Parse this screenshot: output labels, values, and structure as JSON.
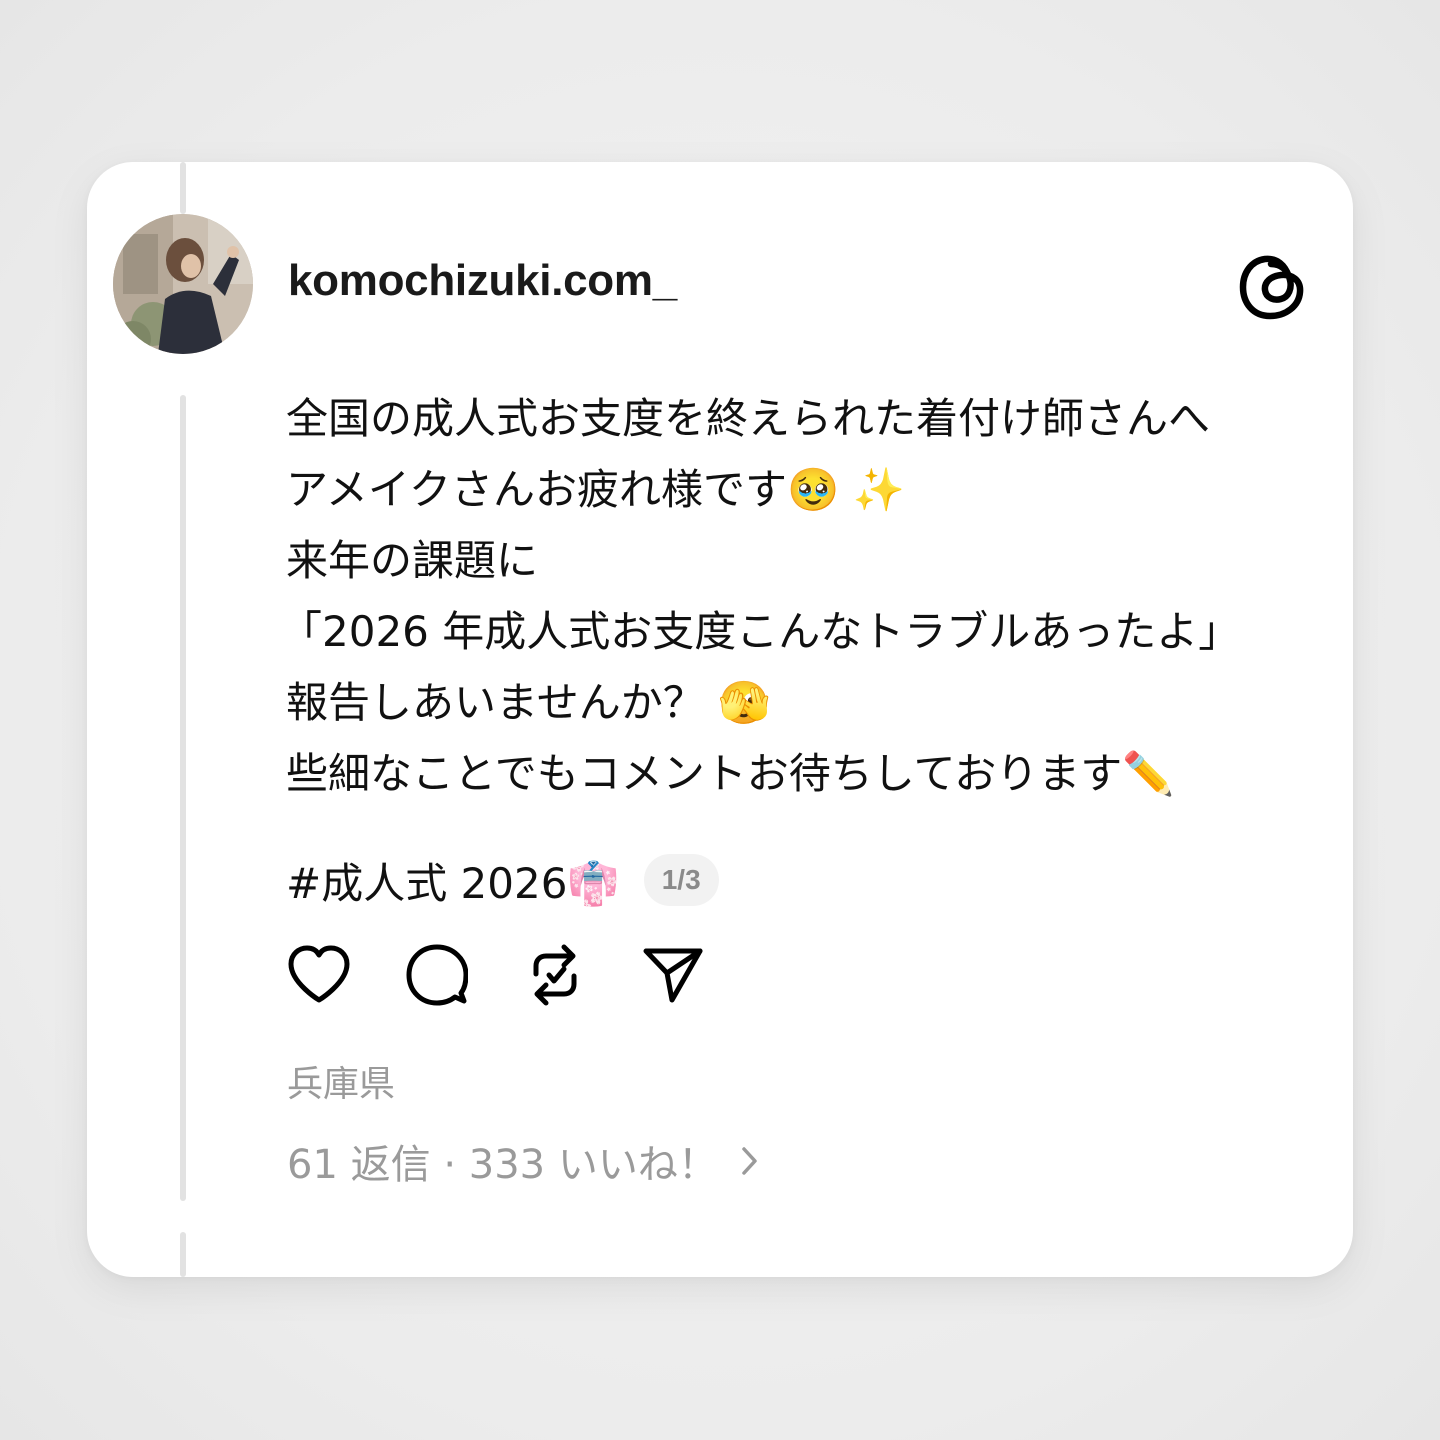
{
  "post": {
    "username": "komochizuki.com_",
    "lines": [
      "全国の成人式お支度を終えられた着付け師さんへ",
      "アメイクさんお疲れ様です🥹 ✨",
      "来年の課題に",
      "「2026 年成人式お支度こんなトラブルあったよ」",
      "報告しあいませんか？ 🫣",
      "些細なことでもコメントお待ちしております✏️"
    ],
    "hashtag": "#成人式 2026👘",
    "page_indicator": "1/3",
    "location": "兵庫県",
    "stats": "61 返信 · 333 いいね！"
  },
  "icons": {
    "brand": "threads-logo-icon",
    "like": "heart-icon",
    "reply": "comment-icon",
    "repost": "repost-icon",
    "share": "send-icon",
    "more": "chevron-right-icon"
  },
  "colors": {
    "background": "#efefef",
    "card": "#ffffff",
    "text": "#111111",
    "muted": "#9a9a9a",
    "thread_line": "#e2e2e2"
  }
}
